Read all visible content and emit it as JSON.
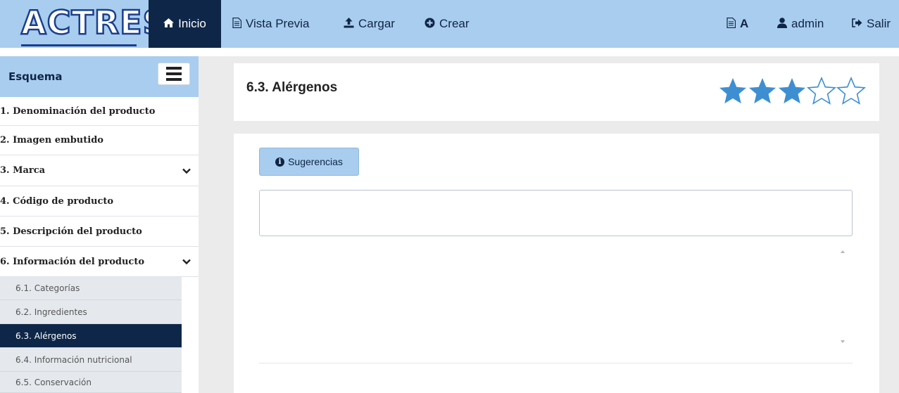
{
  "app": {
    "logo_text": "ACTRES"
  },
  "nav": {
    "items": [
      {
        "label": "Inicio",
        "icon": "home-icon",
        "active": true
      },
      {
        "label": "Vista Previa",
        "icon": "document-icon"
      },
      {
        "label": "Cargar",
        "icon": "upload-icon"
      },
      {
        "label": "Crear",
        "icon": "plus-circle-icon"
      }
    ],
    "right": [
      {
        "label": "A",
        "icon": "document-icon"
      },
      {
        "label": "admin",
        "icon": "user-icon"
      },
      {
        "label": "Salir",
        "icon": "sign-out-icon"
      }
    ]
  },
  "sidebar": {
    "title": "Esquema",
    "items": [
      {
        "label": "1. Denominación del producto"
      },
      {
        "label": "2. Imagen embutido"
      },
      {
        "label": "3. Marca",
        "expandable": true
      },
      {
        "label": "4. Código de producto"
      },
      {
        "label": "5. Descripción del producto"
      },
      {
        "label": "6. Información del producto",
        "expandable": true
      }
    ],
    "subitems": [
      {
        "label": "6.1. Categorías"
      },
      {
        "label": "6.2. Ingredientes"
      },
      {
        "label": "6.3. Alérgenos",
        "active": true
      },
      {
        "label": "6.4. Información nutricional"
      },
      {
        "label": "6.5. Conservación"
      }
    ]
  },
  "main": {
    "title": "6.3. Alérgenos",
    "rating": {
      "value": 3,
      "max": 5
    },
    "suggestions_label": "Sugerencias",
    "input_value": "",
    "textarea_value": ""
  },
  "colors": {
    "navbar": "#a9cdee",
    "active_dark": "#0e2748",
    "logo_stroke": "#1b3f8c",
    "star": "#3d8fd1"
  }
}
